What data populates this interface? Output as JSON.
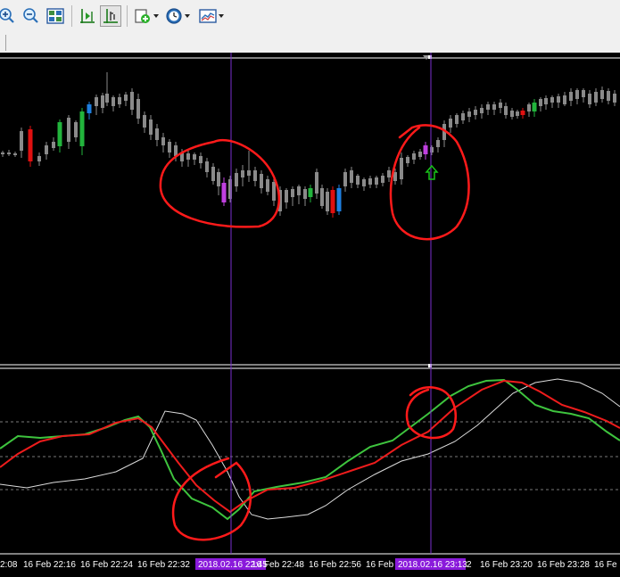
{
  "toolbar": {
    "buttons": [
      {
        "name": "zoom-in-icon"
      },
      {
        "name": "zoom-out-icon"
      },
      {
        "name": "tile-windows-icon"
      },
      {
        "name": "chart-shift-icon"
      },
      {
        "name": "auto-scroll-icon",
        "pressed": true
      },
      {
        "name": "indicators-icon",
        "dropdown": true
      },
      {
        "name": "periods-icon",
        "dropdown": true
      },
      {
        "name": "templates-icon",
        "dropdown": true
      }
    ]
  },
  "time_axis": {
    "labels": [
      "2:08",
      "16 Feb 22:16",
      "16 Feb 22:24",
      "16 Feb 22:32",
      "16 Feb 22:48",
      "16 Feb 22:56",
      "16 Feb",
      "2",
      "16 Feb 23:20",
      "16 Feb 23:28",
      "16 Fe"
    ],
    "highlights": [
      "2018.02.16 22:45",
      "2018.02.16 23:13"
    ]
  },
  "colors": {
    "background": "#000000",
    "bar_neutral": "#8a8a8a",
    "bar_bull": "#22b43c",
    "bar_bear": "#e01010",
    "bar_blue": "#1e7fe0",
    "bar_violet": "#c040e0",
    "vline": "#7a2fd0",
    "label_highlight": "#8a1adb",
    "line_green": "#3ec43e",
    "line_red": "#ee1c1c",
    "line_white": "#dcdcdc",
    "annotation": "#ff1a1a",
    "arrow": "#19c319"
  }
}
